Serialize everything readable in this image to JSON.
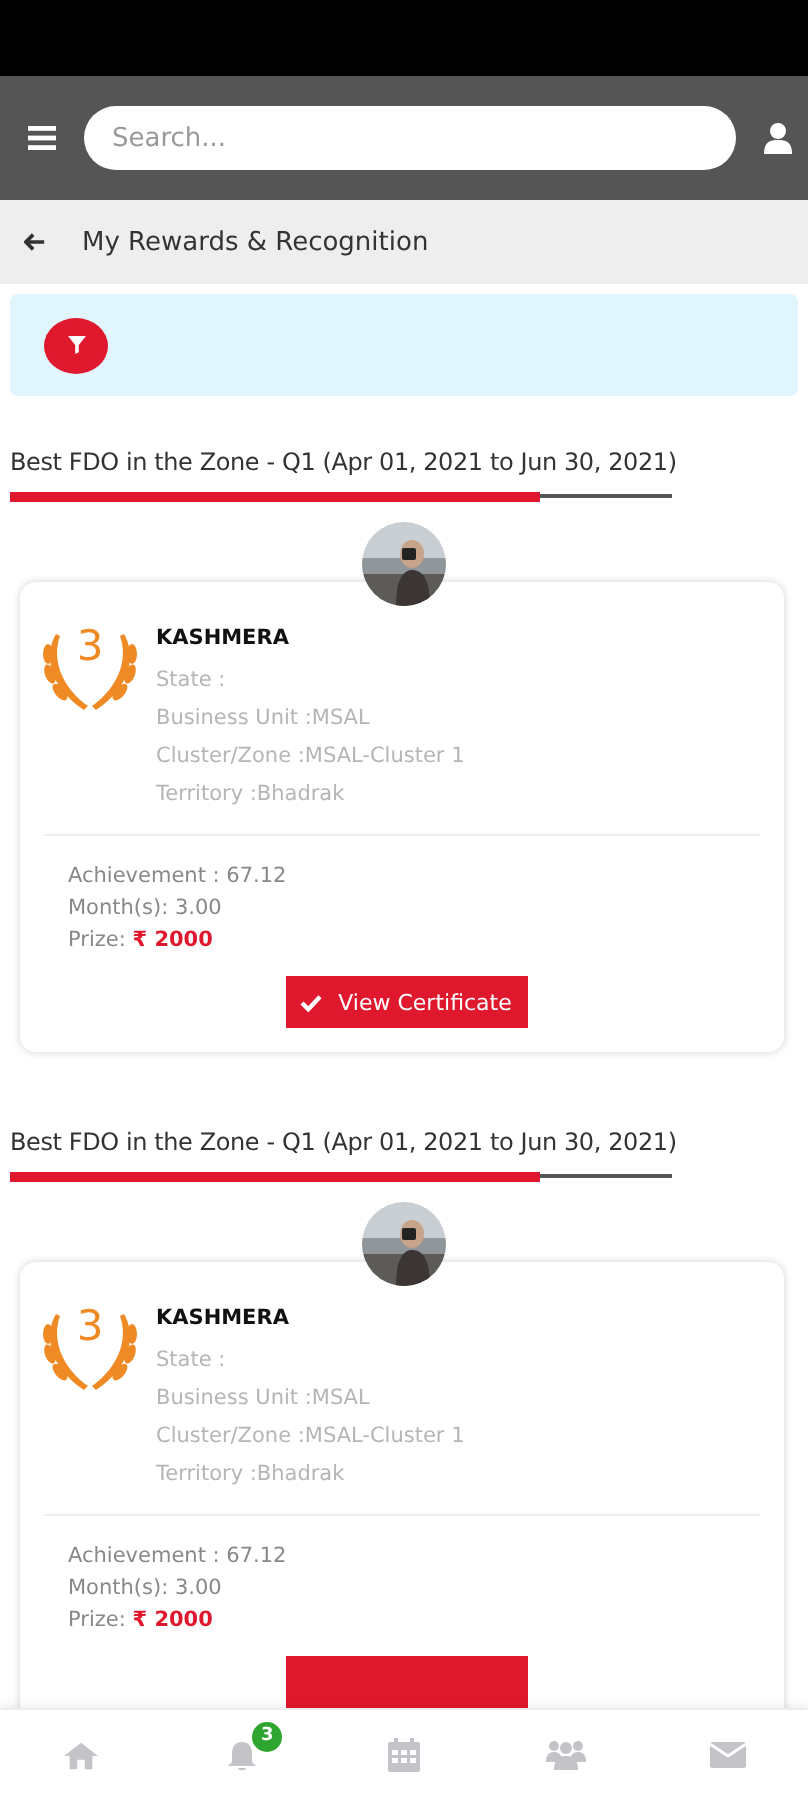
{
  "header": {
    "search": {
      "placeholder": "Search..."
    }
  },
  "page": {
    "title": "My Rewards & Recognition"
  },
  "awards": [
    {
      "title": "Best FDO in the Zone - Q1 (Apr 01, 2021 to Jun 30, 2021)",
      "level": 0.8,
      "rank": "3",
      "name": "KASHMERA",
      "details": [
        "State :",
        "Business Unit :MSAL",
        "Cluster/Zone :MSAL-Cluster 1",
        "Territory :Bhadrak"
      ],
      "achievement": "Achievement : 67.12",
      "months": "Month(s): 3.00",
      "prize_label": "Prize:",
      "prize": "₹ 2000",
      "button": "View Certificate"
    },
    {
      "title": "Best FDO in the Zone - Q1 (Apr 01, 2021 to Jun 30, 2021)",
      "level": 0.8,
      "rank": "3",
      "name": "KASHMERA",
      "details": [
        "State :",
        "Business Unit :MSAL",
        "Cluster/Zone :MSAL-Cluster 1",
        "Territory :Bhadrak"
      ],
      "achievement": "Achievement : 67.12",
      "months": "Month(s): 3.00",
      "prize_label": "Prize:",
      "prize": "₹ 2000"
    }
  ],
  "bottom_nav": [
    {
      "kind": "home"
    },
    {
      "kind": "bell",
      "badge": "3"
    },
    {
      "kind": "calendar"
    },
    {
      "kind": "people"
    },
    {
      "kind": "mail"
    }
  ]
}
